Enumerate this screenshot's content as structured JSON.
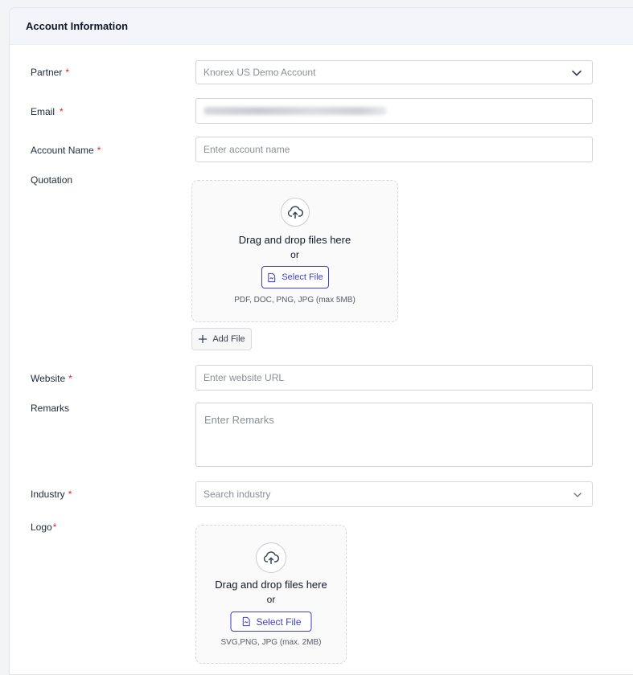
{
  "section": {
    "title": "Account Information"
  },
  "partner": {
    "label": "Partner",
    "required_mark": "*",
    "value": "Knorex US Demo Account"
  },
  "email": {
    "label": "Email",
    "required_mark": "*",
    "value_obscured": true
  },
  "account_name": {
    "label": "Account Name",
    "required_mark": "*",
    "placeholder": "Enter account name"
  },
  "quotation": {
    "label": "Quotation",
    "drop_title": "Drag and drop files here",
    "or_text": "or",
    "select_label": "Select File",
    "hint": "PDF, DOC, PNG, JPG (max 5MB)",
    "add_file_label": "Add File"
  },
  "website": {
    "label": "Website",
    "required_mark": "*",
    "placeholder": "Enter website URL"
  },
  "remarks": {
    "label": "Remarks",
    "placeholder": "Enter Remarks"
  },
  "industry": {
    "label": "Industry",
    "required_mark": "*",
    "placeholder": "Search industry"
  },
  "logo": {
    "label": "Logo",
    "required_mark": "*",
    "drop_title": "Drag and drop files here",
    "or_text": "or",
    "select_label": "Select File",
    "hint": "SVG,PNG, JPG (max. 2MB)"
  },
  "colors": {
    "accent": "#3b3fc2",
    "required": "#dc2626",
    "header_bg": "#f4f5fb"
  }
}
